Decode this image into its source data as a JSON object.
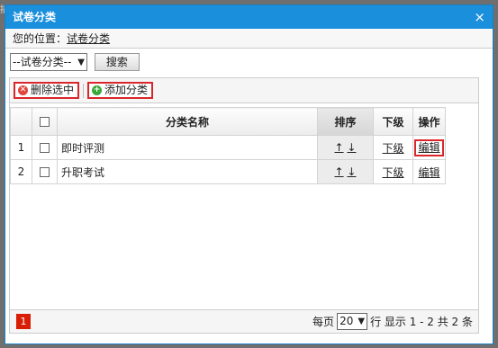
{
  "background": {
    "edge_char": "插"
  },
  "dialog": {
    "title": "试卷分类",
    "close_glyph": "×"
  },
  "breadcrumb": {
    "prefix": "您的位置：",
    "link": "试卷分类"
  },
  "search": {
    "category_select_value": "--试卷分类--",
    "search_button": "搜索"
  },
  "toolbar": {
    "delete_label": "删除选中",
    "add_label": "添加分类"
  },
  "table": {
    "headers": {
      "name": "分类名称",
      "sort": "排序",
      "sub": "下级",
      "action": "操作"
    },
    "rows": [
      {
        "num": "1",
        "name": "即时评测",
        "sort_up": "↑",
        "sort_down": "↓",
        "sub": "下级",
        "action": "编辑"
      },
      {
        "num": "2",
        "name": "升职考试",
        "sort_up": "↑",
        "sort_down": "↓",
        "sub": "下级",
        "action": "编辑"
      }
    ]
  },
  "pager": {
    "current_page": "1",
    "per_page_label": "每页",
    "per_page_value": "20",
    "summary": "行 显示 1 - 2 共 2 条"
  },
  "colors": {
    "title_bar": "#1a8fdc",
    "highlight_red": "#d9262b",
    "page_badge": "#d81e06"
  }
}
